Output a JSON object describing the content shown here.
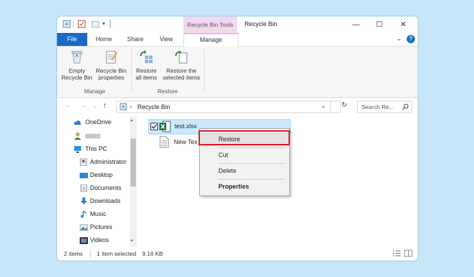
{
  "window": {
    "tools_tab": "Recycle Bin Tools",
    "title": "Recycle Bin"
  },
  "tabs": [
    "File",
    "Home",
    "Share",
    "View",
    "Manage"
  ],
  "ribbon": {
    "buttons": [
      {
        "line1": "Empty",
        "line2": "Recycle Bin"
      },
      {
        "line1": "Recycle Bin",
        "line2": "properties"
      },
      {
        "line1": "Restore",
        "line2": "all items"
      },
      {
        "line1": "Restore the",
        "line2": "selected items"
      }
    ],
    "groups": [
      "Manage",
      "Restore"
    ]
  },
  "address": {
    "path": "Recycle Bin",
    "search_placeholder": "Search Re..."
  },
  "nav_tree": [
    {
      "label": "OneDrive",
      "icon": "cloud-icon"
    },
    {
      "label": "",
      "icon": "user-icon"
    },
    {
      "label": "This PC",
      "icon": "pc-icon"
    },
    {
      "label": "Administrator",
      "icon": "user-folder-icon"
    },
    {
      "label": "Desktop",
      "icon": "desktop-icon"
    },
    {
      "label": "Documents",
      "icon": "documents-icon"
    },
    {
      "label": "Downloads",
      "icon": "downloads-icon"
    },
    {
      "label": "Music",
      "icon": "music-icon"
    },
    {
      "label": "Pictures",
      "icon": "pictures-icon"
    },
    {
      "label": "Videos",
      "icon": "videos-icon"
    }
  ],
  "files": [
    {
      "name": "test.xlsx",
      "icon": "excel-icon",
      "selected": true
    },
    {
      "name": "New Tex",
      "icon": "text-file-icon",
      "selected": false
    }
  ],
  "context_menu": [
    "Restore",
    "Cut",
    "Delete",
    "Properties"
  ],
  "status": {
    "count": "2 items",
    "selection": "1 item selected",
    "size": "9.16 KB"
  },
  "colors": {
    "accent": "#1a6ac6",
    "tools_tab": "#f1d8ee",
    "selection": "#cce8ff",
    "highlight_box": "#e3141b"
  }
}
